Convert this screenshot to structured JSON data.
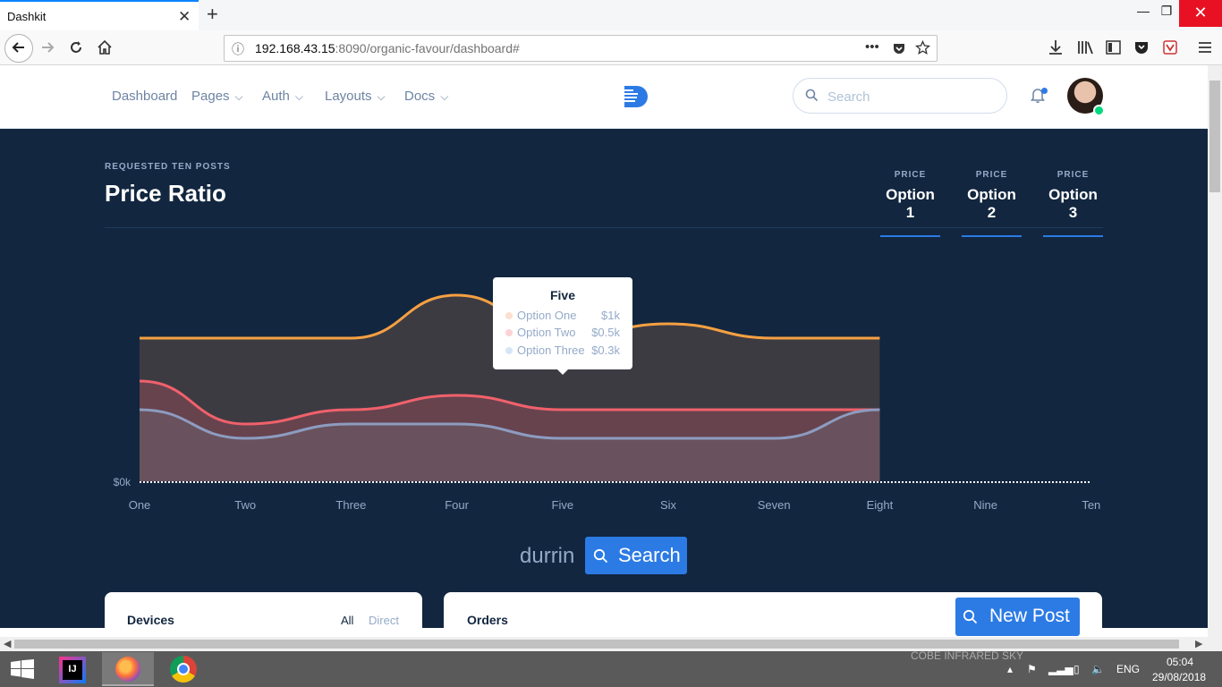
{
  "browser": {
    "tab_title": "Dashkit",
    "tab_close": "✕",
    "new_tab": "+",
    "url_host": "192.168.43.15",
    "url_rest": ":8090/organic-favour/dashboard#",
    "url_more": "•••",
    "window_buttons": [
      "—",
      "❐",
      "✕"
    ]
  },
  "header": {
    "menu": [
      {
        "label": "Dashboard"
      },
      {
        "label": "Pages"
      },
      {
        "label": "Auth"
      },
      {
        "label": "Layouts"
      },
      {
        "label": "Docs"
      }
    ],
    "search_placeholder": "Search"
  },
  "hero": {
    "pretitle": "REQUESTED TEN POSTS",
    "title": "Price Ratio",
    "options": [
      {
        "label": "PRICE",
        "value": "Option 1"
      },
      {
        "label": "PRICE",
        "value": "Option 2"
      },
      {
        "label": "PRICE",
        "value": "Option 3"
      }
    ]
  },
  "chart_data": {
    "type": "area",
    "categories": [
      "One",
      "Two",
      "Three",
      "Four",
      "Five",
      "Six",
      "Seven",
      "Eight",
      "Nine",
      "Ten"
    ],
    "y_tick_label": "$0k",
    "series": [
      {
        "name": "Option One",
        "color": "#f5a042",
        "values": [
          2.0,
          2.0,
          2.0,
          2.6,
          2.0,
          2.2,
          2.0,
          2.0,
          null,
          null
        ]
      },
      {
        "name": "Option Two",
        "color": "#f0616b",
        "values": [
          1.4,
          0.8,
          1.0,
          1.2,
          1.0,
          1.0,
          1.0,
          1.0,
          null,
          null
        ]
      },
      {
        "name": "Option Three",
        "color": "#8d9cc0",
        "values": [
          1.0,
          0.6,
          0.8,
          0.8,
          0.6,
          0.6,
          0.6,
          1.0,
          null,
          null
        ]
      }
    ],
    "tooltip": {
      "title": "Five",
      "rows": [
        {
          "name": "Option One",
          "value": "$1k",
          "color": "#fbe0cf"
        },
        {
          "name": "Option Two",
          "value": "$0.5k",
          "color": "#fbd3d6"
        },
        {
          "name": "Option Three",
          "value": "$0.3k",
          "color": "#d6e6f6"
        }
      ]
    }
  },
  "search_bar": {
    "query": "durrin",
    "button": "Search"
  },
  "cards": {
    "devices": {
      "title": "Devices",
      "tab_all": "All",
      "tab_direct": "Direct"
    },
    "orders": {
      "title": "Orders",
      "button": "New Post"
    }
  },
  "taskbar": {
    "overlay_text": "COBE INFRARED SKY",
    "lang": "ENG",
    "time": "05:04",
    "date": "29/08/2018"
  }
}
